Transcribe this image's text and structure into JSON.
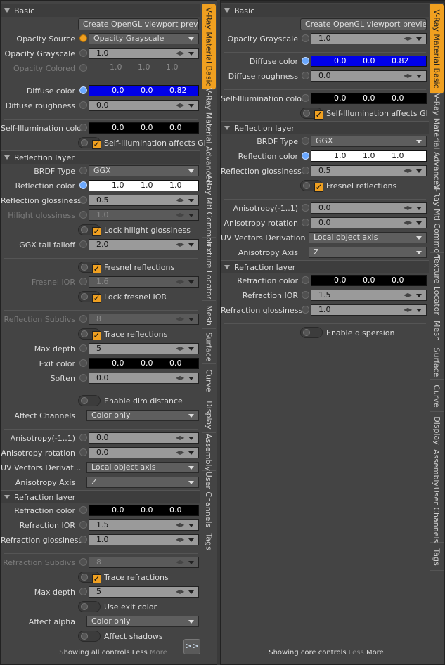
{
  "tabs": [
    "V-Ray Material Basic",
    "V-Ray Material Advanced",
    "V-Ray Mtl Common",
    "Texture Locator",
    "Mesh",
    "Surface",
    "Curve",
    "Display",
    "Assembly",
    "User Channels",
    "Tags"
  ],
  "left": {
    "rows": [
      {
        "t": "header",
        "text": "Basic"
      },
      {
        "t": "button",
        "text": "Create OpenGL viewport previe ..."
      },
      {
        "t": "select",
        "label": "Opacity Source",
        "value": "Opacity Grayscale",
        "circle": "orange"
      },
      {
        "t": "num",
        "label": "Opacity Grayscale",
        "value": "1.0"
      },
      {
        "t": "triple",
        "label": "Opacity Colored",
        "values": [
          "1.0",
          "1.0",
          "1.0"
        ],
        "dim": true
      },
      {
        "t": "sep"
      },
      {
        "t": "color",
        "label": "Diffuse color",
        "values": [
          "0.0",
          "0.0",
          "0.82"
        ],
        "swatch": "blue",
        "circle": "blue"
      },
      {
        "t": "num",
        "label": "Diffuse roughness",
        "value": "0.0"
      },
      {
        "t": "sep"
      },
      {
        "t": "color",
        "label": "Self-Illumination color",
        "values": [
          "0.0",
          "0.0",
          "0.0"
        ],
        "swatch": "black"
      },
      {
        "t": "check",
        "label": "Self-Illumination affects GI",
        "checked": true
      },
      {
        "t": "header",
        "text": "Reflection layer"
      },
      {
        "t": "select",
        "label": "BRDF Type",
        "value": "GGX"
      },
      {
        "t": "color",
        "label": "Reflection color",
        "values": [
          "1.0",
          "1.0",
          "1.0"
        ],
        "swatch": "white",
        "circle": "blue"
      },
      {
        "t": "num",
        "label": "Reflection glossiness",
        "value": "0.5"
      },
      {
        "t": "num",
        "label": "Hilight glossiness",
        "value": "1.0",
        "dim": true
      },
      {
        "t": "check",
        "label": "Lock hilight glossiness",
        "checked": true
      },
      {
        "t": "num",
        "label": "GGX tail falloff",
        "value": "2.0"
      },
      {
        "t": "sep"
      },
      {
        "t": "check",
        "label": "Fresnel reflections",
        "checked": true
      },
      {
        "t": "num",
        "label": "Fresnel IOR",
        "value": "1.6",
        "dim": true
      },
      {
        "t": "check",
        "label": "Lock fresnel IOR",
        "checked": true
      },
      {
        "t": "sep"
      },
      {
        "t": "num",
        "label": "Reflection Subdivs",
        "value": "8",
        "dim": true
      },
      {
        "t": "check",
        "label": "Trace reflections",
        "checked": true
      },
      {
        "t": "num",
        "label": "Max depth",
        "value": "5"
      },
      {
        "t": "color",
        "label": "Exit color",
        "values": [
          "0.0",
          "0.0",
          "0.0"
        ],
        "swatch": "black"
      },
      {
        "t": "num",
        "label": "Soften",
        "value": "0.0"
      },
      {
        "t": "sep"
      },
      {
        "t": "check",
        "label": "Enable dim distance",
        "checked": false
      },
      {
        "t": "select",
        "label": "Affect Channels",
        "value": "Color only",
        "nocircle": true
      },
      {
        "t": "sep"
      },
      {
        "t": "num",
        "label": "Anisotropy(-1..1)",
        "value": "0.0"
      },
      {
        "t": "num",
        "label": "Anisotropy rotation",
        "value": "0.0"
      },
      {
        "t": "select",
        "label": "UV Vectors Derivat...",
        "value": "Local object axis",
        "nocircle": true
      },
      {
        "t": "select",
        "label": "Anisotropy Axis",
        "value": "Z",
        "nocircle": true
      },
      {
        "t": "header",
        "text": "Refraction layer"
      },
      {
        "t": "color",
        "label": "Refraction color",
        "values": [
          "0.0",
          "0.0",
          "0.0"
        ],
        "swatch": "black"
      },
      {
        "t": "num",
        "label": "Refraction IOR",
        "value": "1.5"
      },
      {
        "t": "num",
        "label": "Refraction glossiness",
        "value": "1.0"
      },
      {
        "t": "sep"
      },
      {
        "t": "num",
        "label": "Refraction Subdivs",
        "value": "8",
        "dim": true
      },
      {
        "t": "check",
        "label": "Trace refractions",
        "checked": true
      },
      {
        "t": "num",
        "label": "Max depth",
        "value": "5"
      },
      {
        "t": "check",
        "label": "Use exit color",
        "checked": false
      },
      {
        "t": "select",
        "label": "Affect alpha",
        "value": "Color only",
        "nocircle": true
      },
      {
        "t": "check",
        "label": "Affect shadows",
        "checked": false
      }
    ],
    "footer": {
      "status": "Showing all controls",
      "less": "Less",
      "more": "More",
      "expand": ">>"
    }
  },
  "right": {
    "rows": [
      {
        "t": "header",
        "text": "Basic"
      },
      {
        "t": "button",
        "text": "Create OpenGL viewport preview..."
      },
      {
        "t": "num",
        "label": "Opacity Grayscale",
        "value": "1.0"
      },
      {
        "t": "sep"
      },
      {
        "t": "color",
        "label": "Diffuse color",
        "values": [
          "0.0",
          "0.0",
          "0.82"
        ],
        "swatch": "blue",
        "circle": "blue"
      },
      {
        "t": "num",
        "label": "Diffuse roughness",
        "value": "0.0"
      },
      {
        "t": "sep"
      },
      {
        "t": "color",
        "label": "Self-Illumination color",
        "values": [
          "0.0",
          "0.0",
          "0.0"
        ],
        "swatch": "black"
      },
      {
        "t": "check",
        "label": "Self-Illumination affects GI",
        "checked": true
      },
      {
        "t": "header",
        "text": "Reflection layer"
      },
      {
        "t": "select",
        "label": "BRDF Type",
        "value": "GGX"
      },
      {
        "t": "color",
        "label": "Reflection color",
        "values": [
          "1.0",
          "1.0",
          "1.0"
        ],
        "swatch": "white",
        "circle": "blue"
      },
      {
        "t": "num",
        "label": "Reflection glossiness",
        "value": "0.5"
      },
      {
        "t": "check",
        "label": "Fresnel reflections",
        "checked": true
      },
      {
        "t": "sep"
      },
      {
        "t": "num",
        "label": "Anisotropy(-1..1)",
        "value": "0.0"
      },
      {
        "t": "num",
        "label": "Anisotropy rotation",
        "value": "0.0"
      },
      {
        "t": "select",
        "label": "UV Vectors Derivation",
        "value": "Local object axis",
        "nocircle": true
      },
      {
        "t": "select",
        "label": "Anisotropy Axis",
        "value": "Z",
        "nocircle": true
      },
      {
        "t": "header",
        "text": "Refraction layer"
      },
      {
        "t": "color",
        "label": "Refraction color",
        "values": [
          "0.0",
          "0.0",
          "0.0"
        ],
        "swatch": "black"
      },
      {
        "t": "num",
        "label": "Refraction IOR",
        "value": "1.5"
      },
      {
        "t": "num",
        "label": "Refraction glossiness",
        "value": "1.0"
      },
      {
        "t": "sep"
      },
      {
        "t": "check",
        "label": "Enable dispersion",
        "checked": false
      }
    ],
    "footer": {
      "status": "Showing core controls",
      "less": "Less",
      "more": "More"
    }
  }
}
